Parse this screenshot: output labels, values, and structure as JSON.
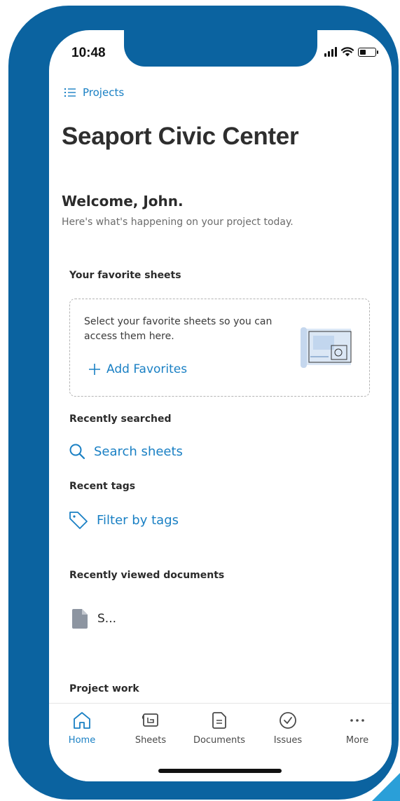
{
  "status": {
    "time": "10:48"
  },
  "breadcrumb": {
    "label": "Projects"
  },
  "project": {
    "title": "Seaport Civic Center"
  },
  "welcome": {
    "greeting": "Welcome, John.",
    "subtitle": "Here's what's happening on your project today."
  },
  "favorites": {
    "heading": "Your favorite sheets",
    "message": "Select your favorite sheets so you can access them here.",
    "add_label": "Add Favorites"
  },
  "recently_searched": {
    "heading": "Recently searched",
    "link": "Search sheets"
  },
  "recent_tags": {
    "heading": "Recent tags",
    "link": "Filter by tags"
  },
  "recently_viewed": {
    "heading": "Recently viewed documents",
    "items": [
      {
        "name": "S..."
      }
    ]
  },
  "project_work": {
    "heading": "Project work"
  },
  "tabbar": {
    "active": "home",
    "tabs": [
      {
        "key": "home",
        "label": "Home",
        "icon": "home-icon"
      },
      {
        "key": "sheets",
        "label": "Sheets",
        "icon": "sheets-icon"
      },
      {
        "key": "documents",
        "label": "Documents",
        "icon": "documents-icon"
      },
      {
        "key": "issues",
        "label": "Issues",
        "icon": "issues-icon"
      },
      {
        "key": "more",
        "label": "More",
        "icon": "more-icon"
      }
    ]
  },
  "colors": {
    "accent": "#1a80c4",
    "device_frame": "#0b63a0",
    "corner_accent": "#2a9fd8"
  }
}
